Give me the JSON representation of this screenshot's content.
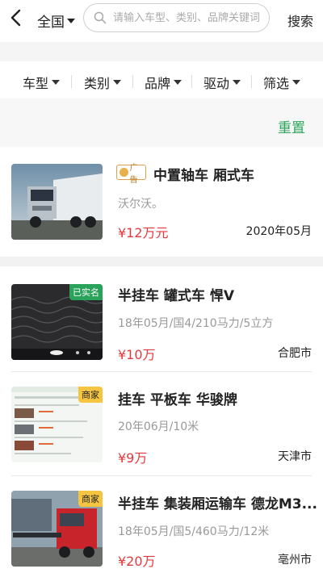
{
  "header": {
    "region": "全国",
    "search_placeholder": "请输入车型、类别、品牌关键词",
    "search_label": "搜索"
  },
  "filters": [
    {
      "label": "车型"
    },
    {
      "label": "类别"
    },
    {
      "label": "品牌"
    },
    {
      "label": "驱动"
    },
    {
      "label": "筛选"
    }
  ],
  "reset_label": "重置",
  "listings": [
    {
      "ad_label": "广告",
      "title": "中置轴车 厢式车",
      "subtitle": "沃尔沃。",
      "price": "¥12万元",
      "right_text": "2020年05月"
    },
    {
      "badge": "已实名",
      "title": "半挂车 罐式车 悍V",
      "subtitle": "18年05月/国4/210马力/5立方",
      "price": "¥10万",
      "right_text": "合肥市"
    },
    {
      "badge": "商家",
      "title": "挂车 平板车 华骏牌",
      "subtitle": "20年06月/10米",
      "price": "¥9万",
      "right_text": "天津市"
    },
    {
      "badge": "商家",
      "title": "半挂车 集装厢运输车 德龙M3...",
      "subtitle": "18年05月/国5/460马力/12米",
      "price": "¥20万",
      "right_text": "亳州市"
    }
  ],
  "colors": {
    "accent_green": "#2aa55a",
    "price_red": "#e4393c",
    "badge_green": "#29a35a",
    "badge_yellow": "#f5c542"
  },
  "icons": {
    "back": "chevron-left-icon",
    "search": "search-icon",
    "dropdown": "triangle-down-icon"
  }
}
